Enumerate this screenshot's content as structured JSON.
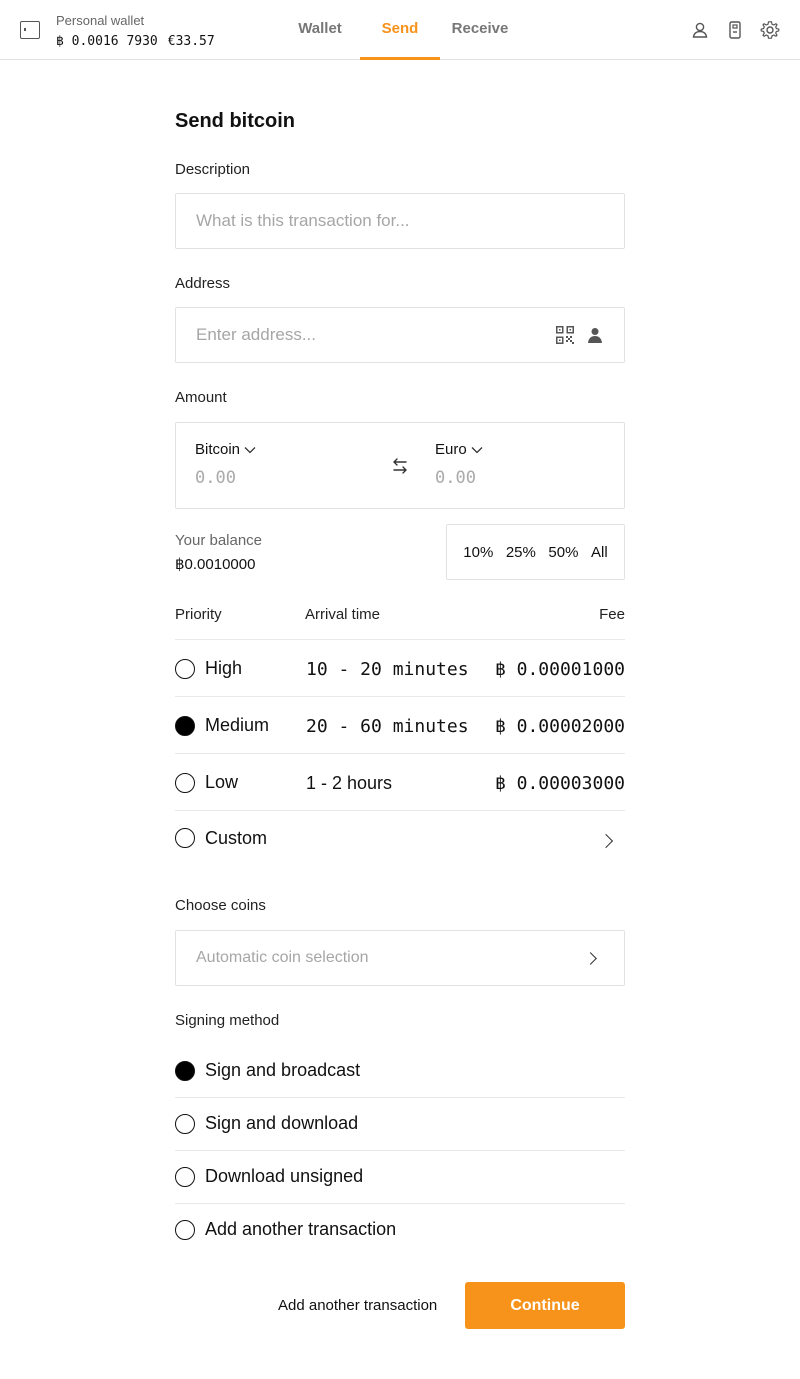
{
  "header": {
    "wallet_name": "Personal wallet",
    "wallet_btc": "฿ 0.0016 7930",
    "wallet_eur": "€33.57",
    "tabs": [
      {
        "label": "Wallet",
        "active": false
      },
      {
        "label": "Send",
        "active": true
      },
      {
        "label": "Receive",
        "active": false
      }
    ],
    "icons": [
      "user-icon",
      "device-icon",
      "gear-icon"
    ]
  },
  "form": {
    "title": "Send bitcoin",
    "description_label": "Description",
    "description_placeholder": "What is this transaction for...",
    "address_label": "Address",
    "address_placeholder": "Enter address...",
    "amount_label": "Amount",
    "amount": {
      "left_currency": "Bitcoin",
      "left_value": "0.00",
      "right_currency": "Euro",
      "right_value": "0.00"
    },
    "balance_label": "Your balance",
    "balance_value": "฿0.0010000",
    "percent_buttons": [
      "10%",
      "25%",
      "50%",
      "All"
    ],
    "priority": {
      "headers": {
        "priority": "Priority",
        "arrival": "Arrival time",
        "fee": "Fee"
      },
      "options": [
        {
          "label": "High",
          "time": "10 - 20 minutes",
          "fee": "฿ 0.00001000",
          "selected": false
        },
        {
          "label": "Medium",
          "time": "20 - 60 minutes",
          "fee": "฿ 0.00002000",
          "selected": true
        },
        {
          "label": "Low",
          "time": "1 - 2 hours",
          "fee": "฿ 0.00003000",
          "selected": false
        }
      ],
      "custom_label": "Custom"
    },
    "coins_label": "Choose coins",
    "coins_placeholder": "Automatic coin selection",
    "signing_label": "Signing method",
    "signing_options": [
      {
        "label": "Sign and broadcast",
        "selected": true
      },
      {
        "label": "Sign and download",
        "selected": false
      },
      {
        "label": "Download unsigned",
        "selected": false
      },
      {
        "label": "Add another transaction",
        "selected": false
      }
    ],
    "footer_link": "Add another transaction",
    "continue_label": "Continue"
  },
  "colors": {
    "accent": "#f7931a",
    "border": "#e2e2e2",
    "muted": "#a6a6a6"
  }
}
